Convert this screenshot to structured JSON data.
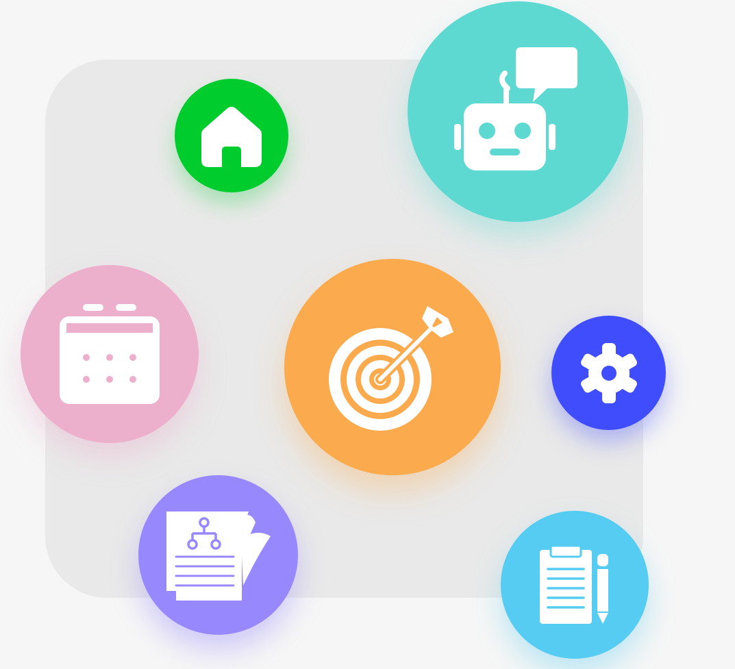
{
  "colors": {
    "page_background": "#f6f6f6",
    "backdrop": "#e9e9e9",
    "home": "#00cc2e",
    "robot": "#5dd9d1",
    "calendar": "#ecb0cc",
    "target": "#fbab4e",
    "settings": "#3f4dfd",
    "document": "#9788fd",
    "clipboard": "#56ccf2",
    "icon_foreground": "#ffffff"
  },
  "icons": [
    {
      "key": "home",
      "icon": "home-icon"
    },
    {
      "key": "robot",
      "icon": "robot-chat-icon"
    },
    {
      "key": "calendar",
      "icon": "calendar-icon"
    },
    {
      "key": "target",
      "icon": "target-arrow-icon"
    },
    {
      "key": "settings",
      "icon": "gear-icon"
    },
    {
      "key": "document",
      "icon": "flowchart-document-icon"
    },
    {
      "key": "clipboard",
      "icon": "clipboard-pencil-icon"
    }
  ]
}
